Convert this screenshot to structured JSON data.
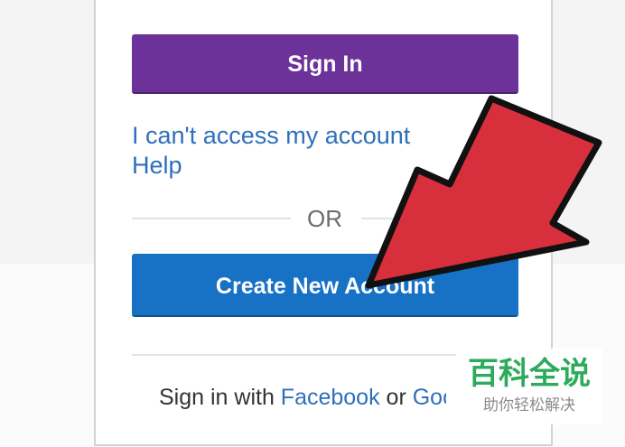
{
  "login": {
    "sign_in_label": "Sign In",
    "cant_access_link": "I can't access my account",
    "help_link": "Help",
    "or_text": "OR",
    "create_account_label": "Create New Account",
    "social": {
      "prefix": "Sign in with ",
      "facebook": "Facebook",
      "or_word": " or ",
      "google": "Google"
    }
  },
  "annotation": {
    "arrow_color": "#d7303c",
    "arrow_outline": "#111111"
  },
  "watermark": {
    "title": "百科全说",
    "subtitle": "助你轻松解决"
  },
  "colors": {
    "sign_in_purple": "#6c3299",
    "create_blue": "#1771c5",
    "link_blue": "#2f6fba",
    "watermark_green": "#2bab5b"
  }
}
